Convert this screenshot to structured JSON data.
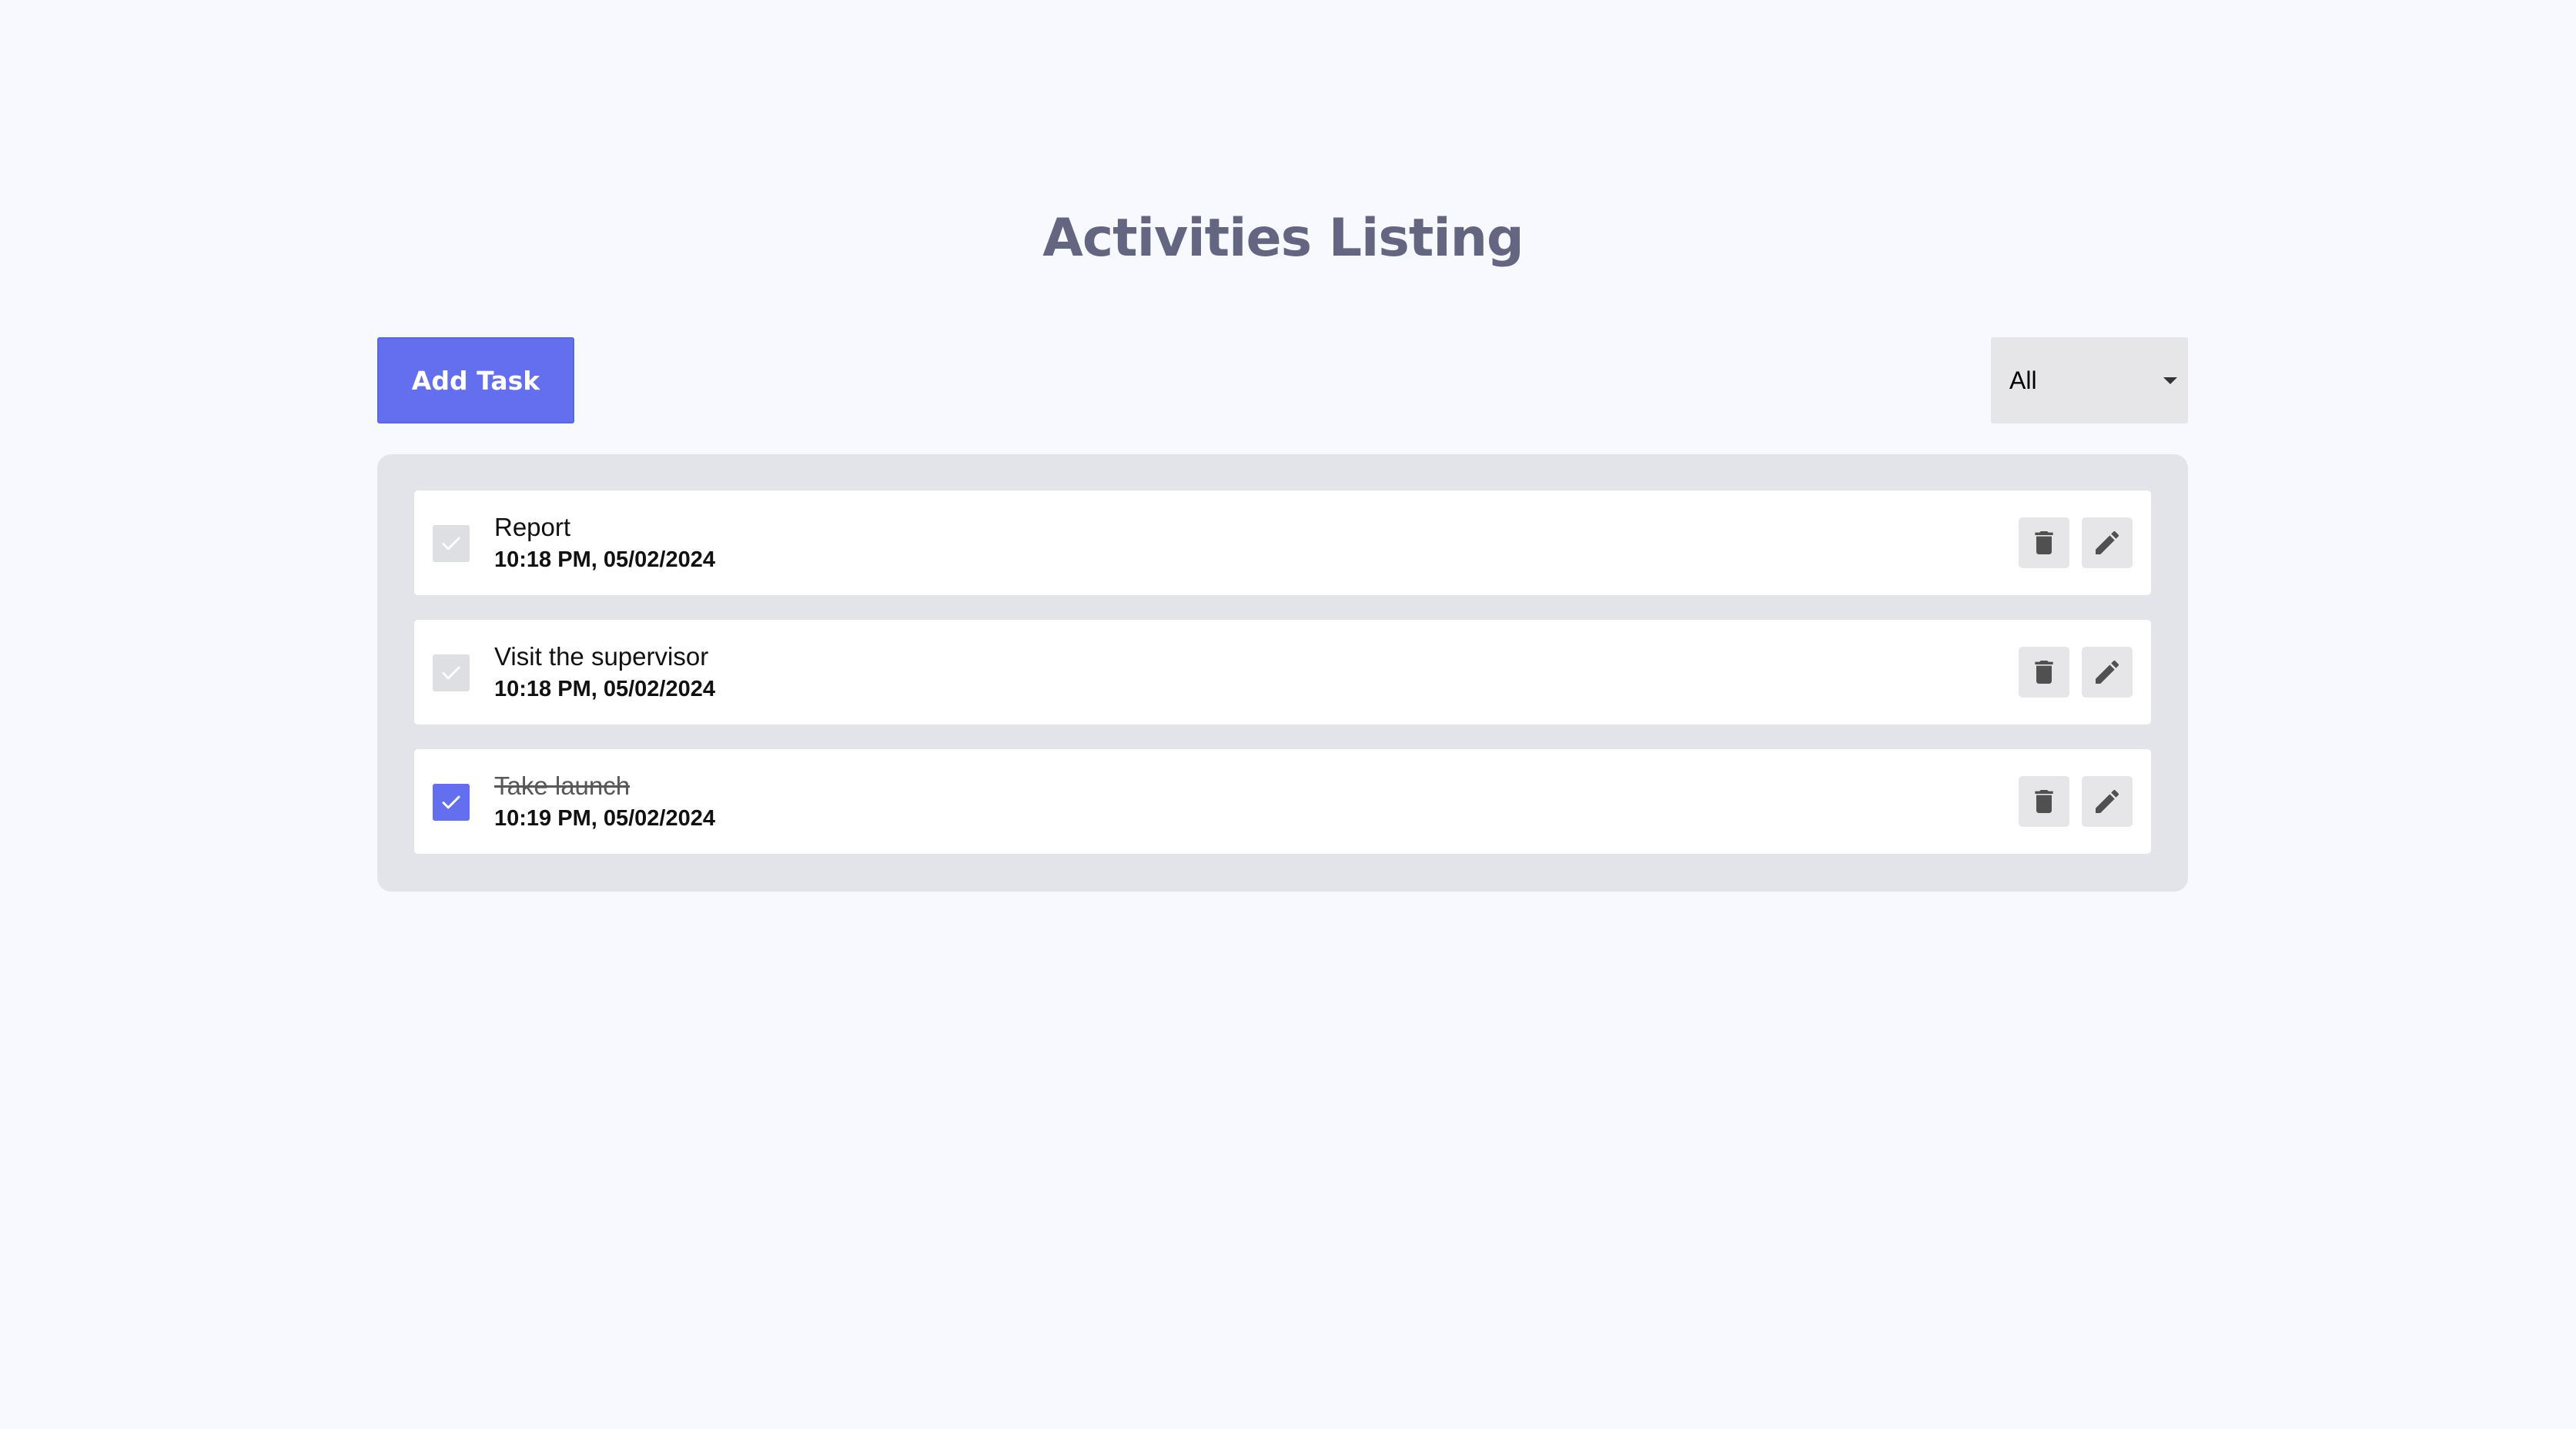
{
  "header": {
    "title": "Activities Listing"
  },
  "toolbar": {
    "add_task_label": "Add Task",
    "filter_selected": "All"
  },
  "tasks": [
    {
      "title": "Report",
      "time": "10:18 PM, 05/02/2024",
      "completed": false
    },
    {
      "title": "Visit the supervisor",
      "time": "10:18 PM, 05/02/2024",
      "completed": false
    },
    {
      "title": "Take launch",
      "time": "10:19 PM, 05/02/2024",
      "completed": true
    }
  ],
  "colors": {
    "accent": "#646ff0",
    "title": "#646681",
    "panel": "#e3e4ea",
    "background": "#f8f9fe"
  },
  "icons": {
    "checkbox": "check-icon",
    "delete": "trash-icon",
    "edit": "pencil-icon",
    "filter": "chevron-down-icon"
  }
}
